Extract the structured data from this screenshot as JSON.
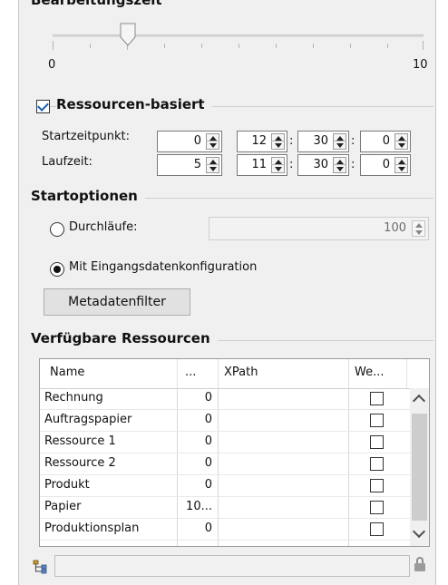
{
  "top_group": {
    "title": "Bearbeitungszeit"
  },
  "slider": {
    "min_label": "0",
    "max_label": "10",
    "value": 2
  },
  "resources_group": {
    "title": "Ressourcen-basiert",
    "checked": true
  },
  "start": {
    "label": "Startzeitpunkt:",
    "days": "0",
    "hours": "12",
    "minutes": "30",
    "seconds": "0"
  },
  "runtime": {
    "label": "Laufzeit:",
    "days": "5",
    "hours": "11",
    "minutes": "30",
    "seconds": "0"
  },
  "time_separator": ":",
  "start_options": {
    "title": "Startoptionen",
    "iterations_label": "Durchläufe:",
    "iterations_value": "100",
    "input_config_label": "Mit Eingangsdatenkonfiguration",
    "metadata_button": "Metadatenfilter"
  },
  "resources_table": {
    "title": "Verfügbare Ressourcen",
    "columns": [
      "Name",
      "...",
      "XPath",
      "We..."
    ],
    "rows": [
      {
        "name": "Rechnung",
        "value": "0"
      },
      {
        "name": "Auftragspapier",
        "value": "0"
      },
      {
        "name": "Ressource 1",
        "value": "0"
      },
      {
        "name": "Ressource 2",
        "value": "0"
      },
      {
        "name": "Produkt",
        "value": "0"
      },
      {
        "name": "Papier",
        "value": "10..."
      },
      {
        "name": "Produktionsplan",
        "value": "0"
      }
    ]
  },
  "bottom_bar": {
    "input_value": ""
  }
}
